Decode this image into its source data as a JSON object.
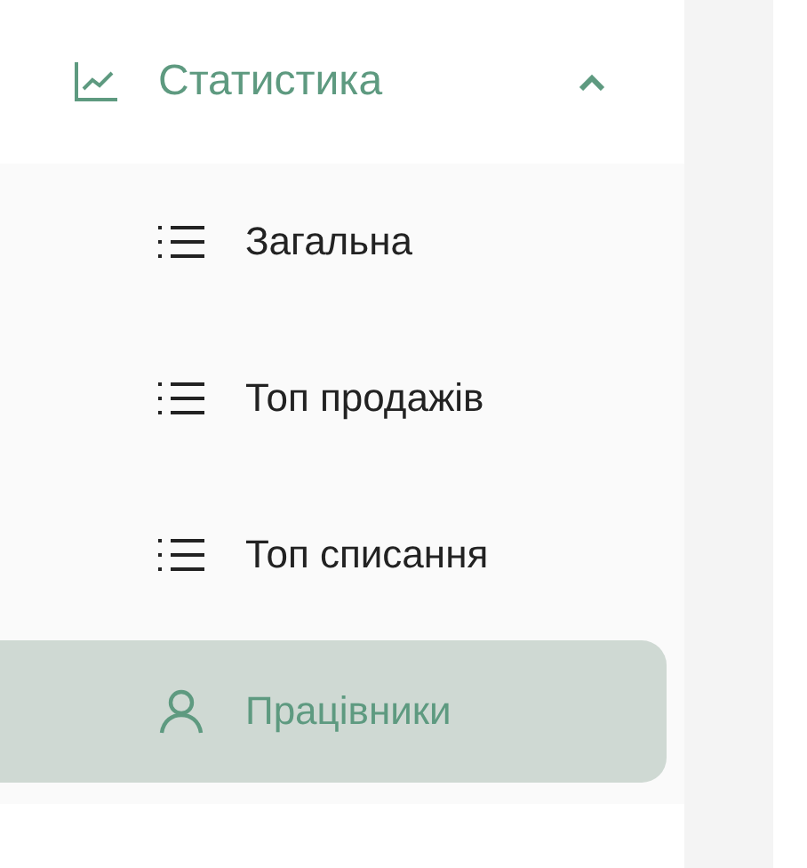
{
  "menu": {
    "label": "Статистика",
    "expanded": true,
    "children": [
      {
        "label": "Загальна",
        "kind": "list",
        "selected": false
      },
      {
        "label": "Топ продажів",
        "kind": "list",
        "selected": false
      },
      {
        "label": "Топ списання",
        "kind": "list",
        "selected": false
      },
      {
        "label": "Працівники",
        "kind": "person",
        "selected": true
      }
    ]
  }
}
